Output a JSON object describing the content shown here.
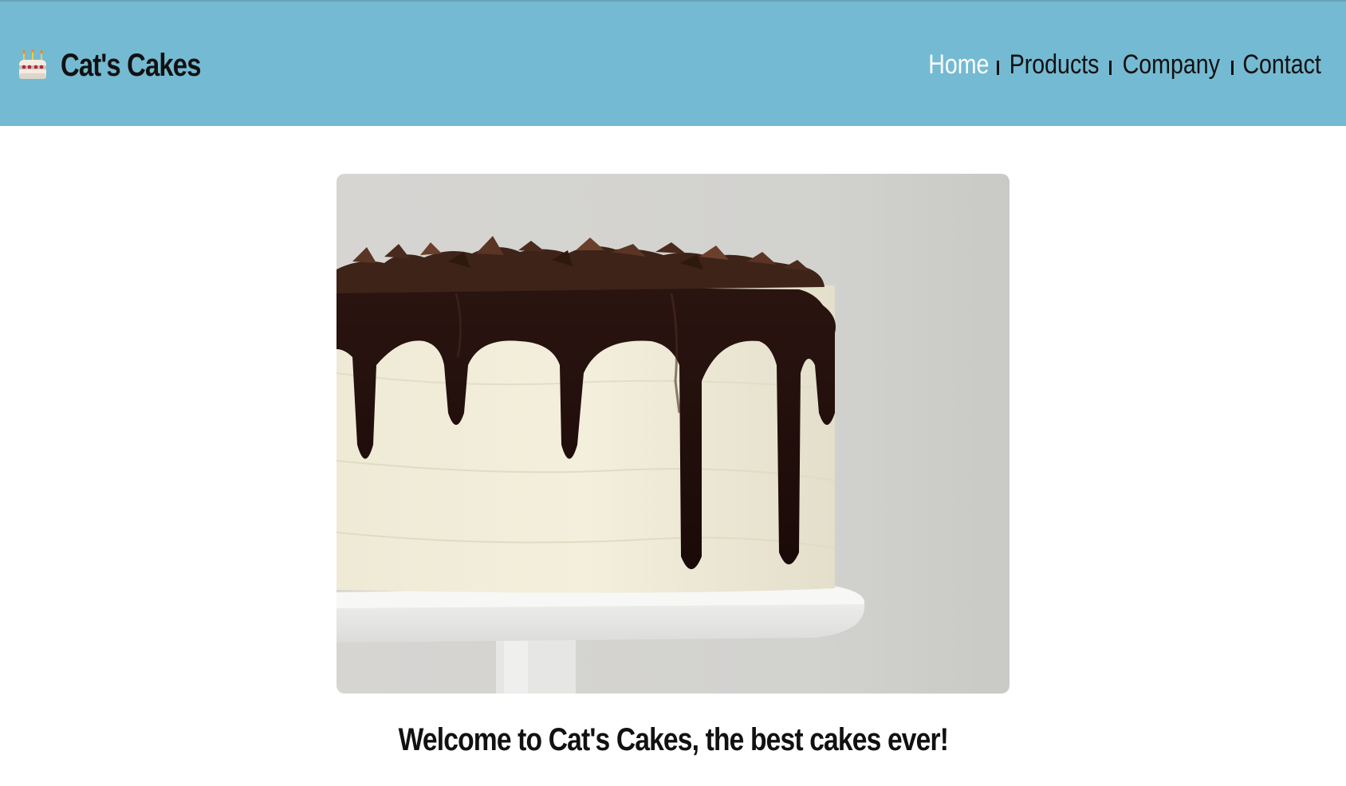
{
  "header": {
    "brand": "Cat's Cakes",
    "brand_icon": "birthday-cake-icon",
    "background_color": "#74bad2"
  },
  "nav": {
    "items": [
      {
        "label": "Home",
        "active": true
      },
      {
        "label": "Products",
        "active": false
      },
      {
        "label": "Company",
        "active": false
      },
      {
        "label": "Contact",
        "active": false
      }
    ],
    "active_color": "#ffffff",
    "separator": "|"
  },
  "hero": {
    "image_icon": "chocolate-drip-cake-photo"
  },
  "main": {
    "welcome": "Welcome to Cat's Cakes, the best cakes ever!"
  }
}
